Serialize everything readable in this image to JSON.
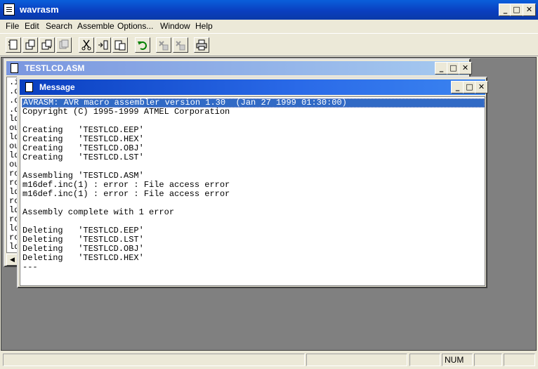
{
  "app": {
    "title": "wavrasm"
  },
  "menu": [
    "File",
    "Edit",
    "Search",
    "Assemble",
    "Options...",
    "Window",
    "Help"
  ],
  "toolbar": {
    "buttons": [
      "new-file",
      "open-file",
      "save-file",
      "save-all",
      "cut",
      "copy",
      "paste",
      "undo",
      "find",
      "find-next",
      "print"
    ]
  },
  "child": {
    "title": "TESTLCD.ASM",
    "visible_text": ".i\n.d\n.d\n.d\nld\nou\nld\nou\nld\nou\nrc\nrc\nld\nrc\nld\nrc\nld\nrc\nld"
  },
  "message": {
    "title": "Message",
    "lines": [
      "AVRASM: AVR macro assembler version 1.30  (Jan 27 1999 01:30:00)",
      "Copyright (C) 1995-1999 ATMEL Corporation",
      "",
      "Creating   'TESTLCD.EEP'",
      "Creating   'TESTLCD.HEX'",
      "Creating   'TESTLCD.OBJ'",
      "Creating   'TESTLCD.LST'",
      "",
      "Assembling 'TESTLCD.ASM'",
      "m16def.inc(1) : error : File access error",
      "m16def.inc(1) : error : File access error",
      "",
      "Assembly complete with 1 error",
      "",
      "Deleting   'TESTLCD.EEP'",
      "Deleting   'TESTLCD.LST'",
      "Deleting   'TESTLCD.OBJ'",
      "Deleting   'TESTLCD.HEX'",
      "---"
    ]
  },
  "status": {
    "num": "NUM"
  },
  "colors": {
    "titlebar": "#0a3fc0",
    "selection": "#316ac5",
    "workspace": "#808080"
  }
}
